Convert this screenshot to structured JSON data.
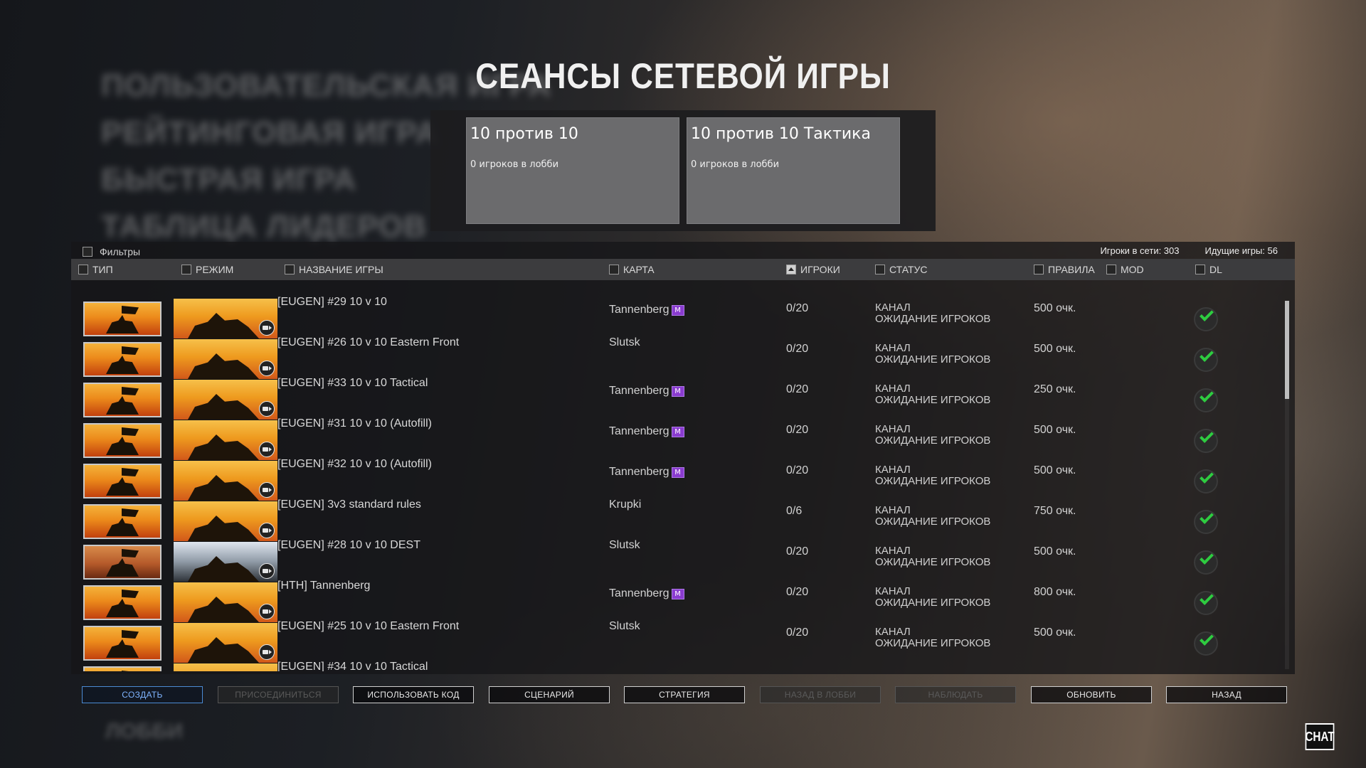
{
  "background_menu": [
    "ПОЛЬЗОВАТЕЛЬСКАЯ ИГРА",
    "РЕЙТИНГОВАЯ ИГРА",
    "БЫСТРАЯ ИГРА",
    "ТАБЛИЦА ЛИДЕРОВ"
  ],
  "background_extra": "ЛОББИ",
  "title": "СЕАНСЫ СЕТЕВОЙ ИГРЫ",
  "mode_cards": [
    {
      "title": "10 против 10",
      "subtitle": "0 игроков в лобби"
    },
    {
      "title": "10 против 10 Тактика",
      "subtitle": "0 игроков в лобби"
    }
  ],
  "filters_label": "Фильтры",
  "stats": {
    "online": "Игроки в сети: 303",
    "games": "Идущие игры: 56"
  },
  "columns": {
    "type": "ТИП",
    "mode": "РЕЖИМ",
    "name": "НАЗВАНИЕ ИГРЫ",
    "map": "КАРТА",
    "players": "ИГРОКИ",
    "status": "СТАТУС",
    "rules": "ПРАВИЛА",
    "mod": "MOD",
    "dl": "DL"
  },
  "mod_badge_text": "M",
  "rows": [
    {
      "name": "[EUGEN] #29 10 v 10",
      "map": "Tannenberg",
      "mod": true,
      "players": "0/20",
      "status1": "КАНАЛ",
      "status2": "ОЖИДАНИЕ ИГРОКОВ",
      "rules": "500 очк.",
      "theme": "sunset"
    },
    {
      "name": "[EUGEN] #26 10 v 10 Eastern Front",
      "map": "Slutsk",
      "mod": false,
      "players": "0/20",
      "status1": "КАНАЛ",
      "status2": "ОЖИДАНИЕ ИГРОКОВ",
      "rules": "500 очк.",
      "theme": "sunset"
    },
    {
      "name": "[EUGEN] #33 10 v 10 Tactical",
      "map": "Tannenberg",
      "mod": true,
      "players": "0/20",
      "status1": "КАНАЛ",
      "status2": "ОЖИДАНИЕ ИГРОКОВ",
      "rules": "250 очк.",
      "theme": "sunset"
    },
    {
      "name": "[EUGEN] #31 10 v 10 (Autofill)",
      "map": "Tannenberg",
      "mod": true,
      "players": "0/20",
      "status1": "КАНАЛ",
      "status2": "ОЖИДАНИЕ ИГРОКОВ",
      "rules": "500 очк.",
      "theme": "sunset"
    },
    {
      "name": "[EUGEN] #32 10 v 10 (Autofill)",
      "map": "Tannenberg",
      "mod": true,
      "players": "0/20",
      "status1": "КАНАЛ",
      "status2": "ОЖИДАНИЕ ИГРОКОВ",
      "rules": "500 очк.",
      "theme": "sunset"
    },
    {
      "name": "[EUGEN] 3v3 standard rules",
      "map": "Krupki",
      "mod": false,
      "players": "0/6",
      "status1": "КАНАЛ",
      "status2": "ОЖИДАНИЕ ИГРОКОВ",
      "rules": "750 очк.",
      "theme": "sunset"
    },
    {
      "name": "[EUGEN] #28 10 v 10 DEST",
      "map": "Slutsk",
      "mod": false,
      "players": "0/20",
      "status1": "КАНАЛ",
      "status2": "ОЖИДАНИЕ ИГРОКОВ",
      "rules": "500 очк.",
      "theme": "dark"
    },
    {
      "name": "[HTH] Tannenberg",
      "map": "Tannenberg",
      "mod": true,
      "players": "0/20",
      "status1": "КАНАЛ",
      "status2": "ОЖИДАНИЕ ИГРОКОВ",
      "rules": "800 очк.",
      "theme": "sunset"
    },
    {
      "name": "[EUGEN] #25 10 v 10 Eastern Front",
      "map": "Slutsk",
      "mod": false,
      "players": "0/20",
      "status1": "КАНАЛ",
      "status2": "ОЖИДАНИЕ ИГРОКОВ",
      "rules": "500 очк.",
      "theme": "sunset"
    },
    {
      "name": "[EUGEN] #34 10 v 10 Tactical",
      "map": "",
      "mod": false,
      "players": "",
      "status1": "",
      "status2": "",
      "rules": "",
      "theme": "sunset"
    }
  ],
  "buttons": [
    {
      "label": "СОЗДАТЬ",
      "state": "primary"
    },
    {
      "label": "ПРИСОЕДИНИТЬСЯ",
      "state": "disabled"
    },
    {
      "label": "ИСПОЛЬЗОВАТЬ КОД",
      "state": "normal"
    },
    {
      "label": "СЦЕНАРИЙ",
      "state": "normal"
    },
    {
      "label": "СТРАТЕГИЯ",
      "state": "normal"
    },
    {
      "label": "НАЗАД В ЛОББИ",
      "state": "disabled"
    },
    {
      "label": "НАБЛЮДАТЬ",
      "state": "disabled"
    },
    {
      "label": "ОБНОВИТЬ",
      "state": "normal"
    },
    {
      "label": "НАЗАД",
      "state": "normal"
    }
  ],
  "chat_label": "CHAT",
  "colors": {
    "accent_blue": "#4b8bd4",
    "mod_purple": "#8a3ccf",
    "ready_green": "#2ecc40"
  }
}
